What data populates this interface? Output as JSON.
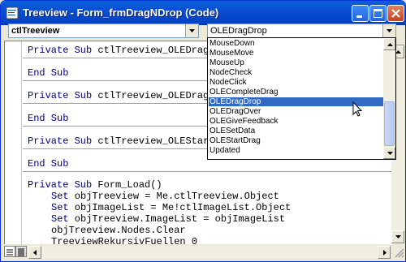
{
  "window": {
    "title": "Treeview - Form_frmDragNDrop (Code)"
  },
  "object_combo": {
    "value": "ctlTreeview"
  },
  "procedure_combo": {
    "value": "OLEDragDrop"
  },
  "procedure_list": {
    "items": [
      "MouseDown",
      "MouseMove",
      "MouseUp",
      "NodeCheck",
      "NodeClick",
      "OLECompleteDrag",
      "OLEDragDrop",
      "OLEDragOver",
      "OLEGiveFeedback",
      "OLESetData",
      "OLEStartDrag",
      "Updated"
    ],
    "selected_index": 6
  },
  "code": {
    "lines": [
      {
        "indent": 0,
        "kw": "Private Sub",
        "rest": " ctlTreeview_OLEDragD"
      },
      {
        "indent": 0,
        "kw": "End Sub",
        "rest": ""
      },
      {
        "indent": 0,
        "kw": "Private Sub",
        "rest": " ctlTreeview_OLEDragO"
      },
      {
        "indent": 0,
        "kw": "End Sub",
        "rest": ""
      },
      {
        "indent": 0,
        "kw": "Private Sub",
        "rest": " ctlTreeview_OLEStart"
      },
      {
        "indent": 0,
        "kw": "End Sub",
        "rest": ""
      },
      {
        "indent": 0,
        "kw": "Private Sub",
        "rest": " Form_Load()"
      },
      {
        "indent": 1,
        "kw": "Set",
        "rest": " objTreeview = Me.ctlTreeview.Object"
      },
      {
        "indent": 1,
        "kw": "Set",
        "rest": " objImageList = Me!ctlImageList.Object"
      },
      {
        "indent": 1,
        "kw": "Set",
        "rest": " objTreeview.ImageList = objImageList"
      },
      {
        "indent": 1,
        "kw": "",
        "rest": "objTreeview.Nodes.Clear"
      },
      {
        "indent": 1,
        "kw": "",
        "rest": "TreeviewRekursivFuellen 0"
      }
    ]
  },
  "icons": {
    "app": "vba-module-icon",
    "minimize": "minimize-icon",
    "maximize": "maximize-icon",
    "close": "close-icon"
  },
  "colors": {
    "keyword": "#00007f",
    "selection": "#316ac5",
    "titlebar": "#0a4fd0"
  }
}
